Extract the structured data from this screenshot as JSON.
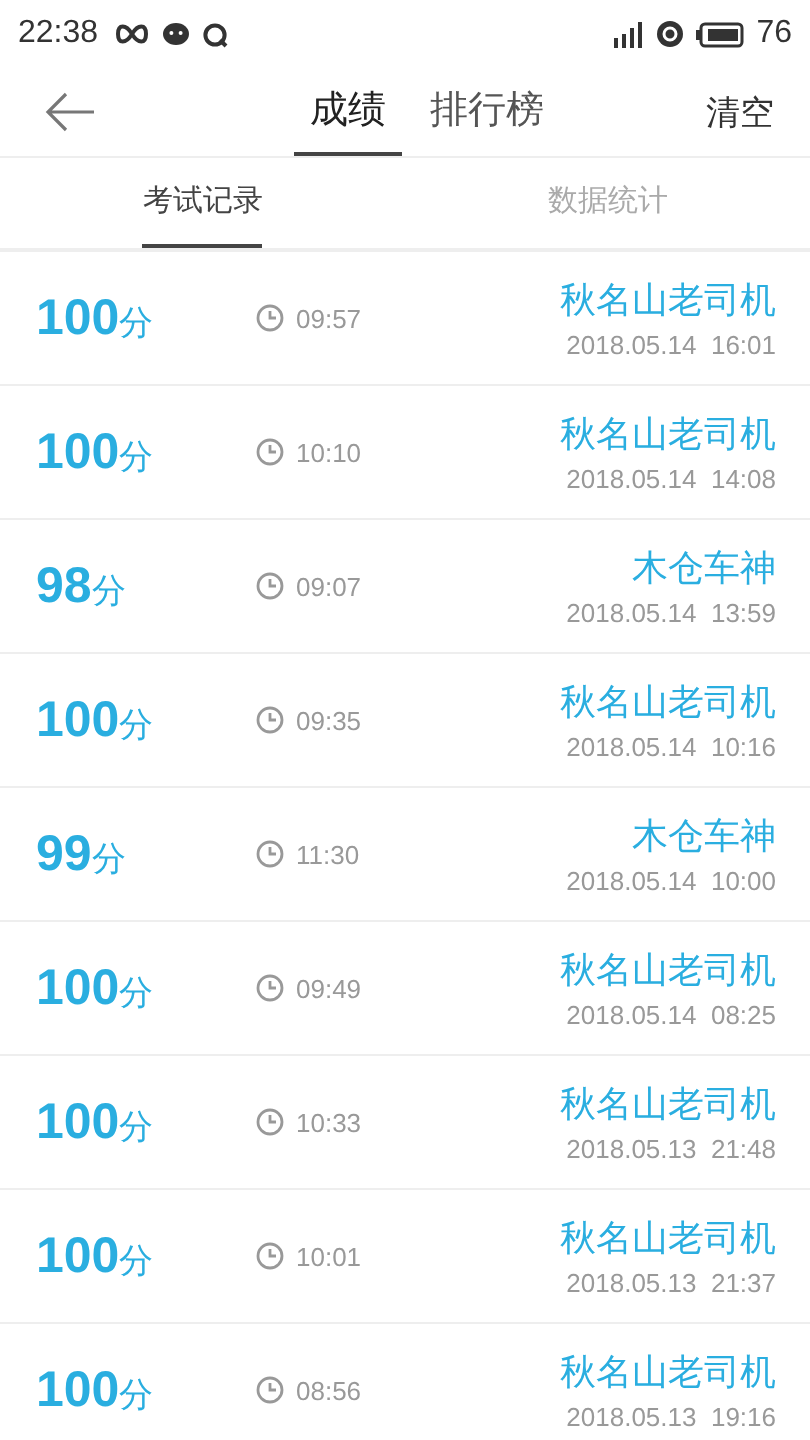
{
  "status_bar": {
    "time": "22:38",
    "battery": "76"
  },
  "header": {
    "tabs": [
      {
        "label": "成绩",
        "selected": true
      },
      {
        "label": "排行榜",
        "selected": false
      }
    ],
    "action": "清空"
  },
  "subtabs": [
    {
      "label": "考试记录",
      "selected": true
    },
    {
      "label": "数据统计",
      "selected": false
    }
  ],
  "records": [
    {
      "score": "100",
      "unit": "分",
      "duration": "09:57",
      "name": "秋名山老司机",
      "date": "2018.05.14  16:01"
    },
    {
      "score": "100",
      "unit": "分",
      "duration": "10:10",
      "name": "秋名山老司机",
      "date": "2018.05.14  14:08"
    },
    {
      "score": "98",
      "unit": "分",
      "duration": "09:07",
      "name": "木仓车神",
      "date": "2018.05.14  13:59"
    },
    {
      "score": "100",
      "unit": "分",
      "duration": "09:35",
      "name": "秋名山老司机",
      "date": "2018.05.14  10:16"
    },
    {
      "score": "99",
      "unit": "分",
      "duration": "11:30",
      "name": "木仓车神",
      "date": "2018.05.14  10:00"
    },
    {
      "score": "100",
      "unit": "分",
      "duration": "09:49",
      "name": "秋名山老司机",
      "date": "2018.05.14  08:25"
    },
    {
      "score": "100",
      "unit": "分",
      "duration": "10:33",
      "name": "秋名山老司机",
      "date": "2018.05.13  21:48"
    },
    {
      "score": "100",
      "unit": "分",
      "duration": "10:01",
      "name": "秋名山老司机",
      "date": "2018.05.13  21:37"
    },
    {
      "score": "100",
      "unit": "分",
      "duration": "08:56",
      "name": "秋名山老司机",
      "date": "2018.05.13  19:16"
    }
  ]
}
